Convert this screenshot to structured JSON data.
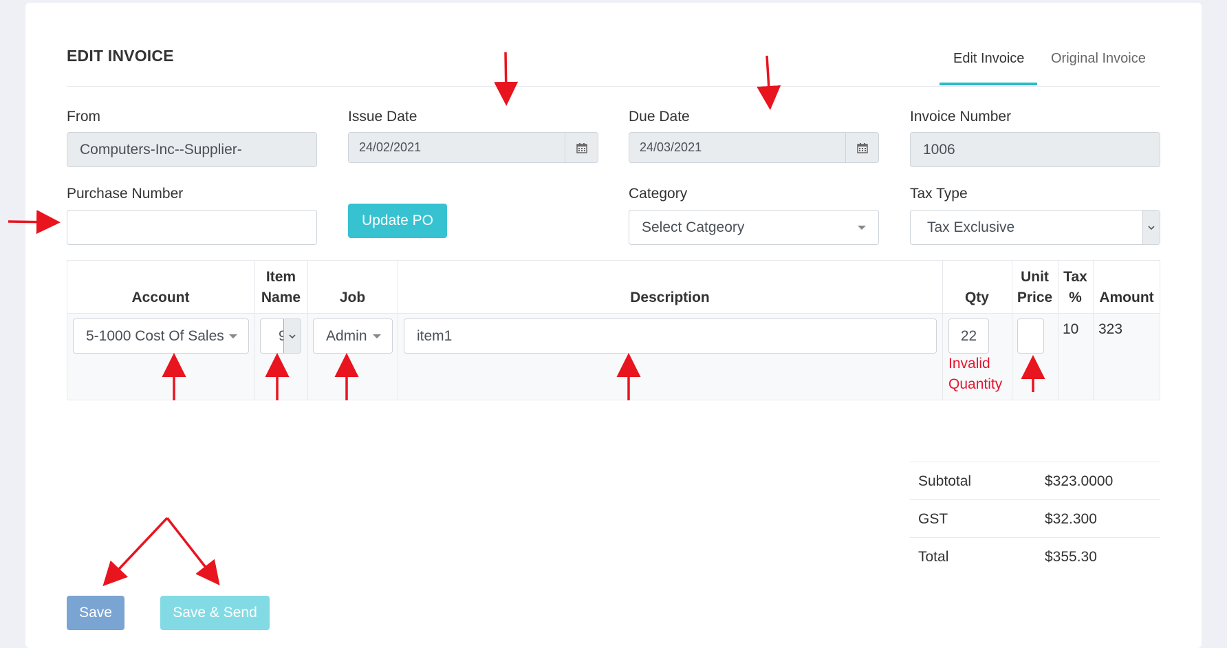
{
  "header": {
    "title": "EDIT INVOICE",
    "tabs": [
      {
        "label": "Edit Invoice",
        "active": true
      },
      {
        "label": "Original Invoice",
        "active": false
      }
    ]
  },
  "form": {
    "from": {
      "label": "From",
      "value": "Computers-Inc--Supplier-"
    },
    "issue_date": {
      "label": "Issue Date",
      "value": "24/02/2021"
    },
    "due_date": {
      "label": "Due Date",
      "value": "24/03/2021"
    },
    "invoice_number": {
      "label": "Invoice Number",
      "value": "1006"
    },
    "purchase_number": {
      "label": "Purchase Number",
      "value": ""
    },
    "update_po_label": "Update PO",
    "category": {
      "label": "Category",
      "value": "Select Catgeory"
    },
    "tax_type": {
      "label": "Tax Type",
      "value": "Tax Exclusive"
    }
  },
  "table": {
    "headers": {
      "account": "Account",
      "item_name_1": "Item",
      "item_name_2": "Name",
      "job": "Job",
      "description": "Description",
      "qty": "Qty",
      "unit_price_1": "Unit",
      "unit_price_2": "Price",
      "tax_1": "Tax",
      "tax_2": "%",
      "amount": "Amount"
    },
    "row": {
      "account": "5-1000 Cost Of Sales",
      "item_name": "9",
      "job": "Admin",
      "description": "item1",
      "qty": "22",
      "qty_error_1": "Invalid",
      "qty_error_2": "Quantity",
      "unit_price": "",
      "tax": "10",
      "amount": "323"
    }
  },
  "totals": {
    "subtotal_label": "Subtotal",
    "subtotal_value": "$323.0000",
    "gst_label": "GST",
    "gst_value": "$32.300",
    "total_label": "Total",
    "total_value": "$355.30"
  },
  "actions": {
    "save_label": "Save",
    "save_send_label": "Save & Send"
  },
  "colors": {
    "accent": "#2bbbc9",
    "update_po": "#36c2d1",
    "save": "#7aa4d2",
    "save_send": "#82dbe4",
    "error": "#e6162d",
    "annotation_arrow": "#e8141e"
  }
}
